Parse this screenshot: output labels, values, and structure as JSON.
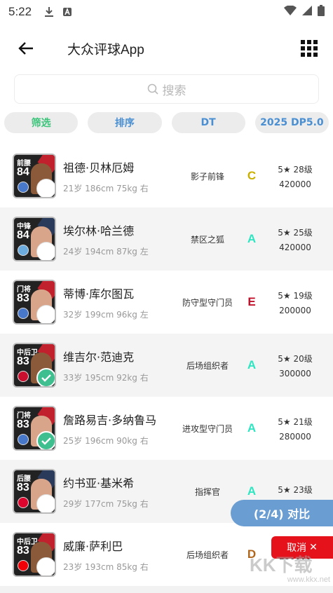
{
  "status": {
    "time": "5:22"
  },
  "header": {
    "title": "大众评球App"
  },
  "search": {
    "placeholder": "搜索"
  },
  "filters": [
    {
      "label": "筛选",
      "color": "#3cc47a"
    },
    {
      "label": "排序",
      "color": "#4a8fd1"
    },
    {
      "label": "DT",
      "color": "#4a8fd1"
    },
    {
      "label": "2025 DP5.0",
      "color": "#4a8fd1"
    }
  ],
  "players": [
    {
      "pos": "前腰",
      "rating": "84",
      "name": "祖德·贝林厄姆",
      "meta": "21岁 186cm 75kg 右",
      "role": "影子前锋",
      "grade": "C",
      "grade_color": "#c9b000",
      "stars_level": "5★ 28级",
      "price": "420000",
      "checked": false
    },
    {
      "pos": "中锋",
      "rating": "84",
      "name": "埃尔林·哈兰德",
      "meta": "24岁 194cm 87kg 左",
      "role": "禁区之狐",
      "grade": "A",
      "grade_color": "#2ce6c2",
      "stars_level": "5★ 25级",
      "price": "420000",
      "checked": false
    },
    {
      "pos": "门将",
      "rating": "83",
      "name": "蒂博·库尔图瓦",
      "meta": "32岁 199cm 96kg 左",
      "role": "防守型守门员",
      "grade": "E",
      "grade_color": "#c0102a",
      "stars_level": "5★ 19级",
      "price": "200000",
      "checked": false
    },
    {
      "pos": "中后卫",
      "rating": "83",
      "name": "维吉尔·范迪克",
      "meta": "33岁 195cm 92kg 右",
      "role": "后场组织者",
      "grade": "A",
      "grade_color": "#2ce6c2",
      "stars_level": "5★ 20级",
      "price": "300000",
      "checked": true
    },
    {
      "pos": "门将",
      "rating": "83",
      "name": "詹路易吉·多纳鲁马",
      "meta": "25岁 196cm 90kg 右",
      "role": "进攻型守门员",
      "grade": "A",
      "grade_color": "#2ce6c2",
      "stars_level": "5★ 21级",
      "price": "280000",
      "checked": true
    },
    {
      "pos": "后腰",
      "rating": "83",
      "name": "约书亚·基米希",
      "meta": "29岁 177cm 75kg 右",
      "role": "指挥官",
      "grade": "A",
      "grade_color": "#2ce6c2",
      "stars_level": "5★ 23级",
      "price": "",
      "checked": false
    },
    {
      "pos": "中后卫",
      "rating": "83",
      "name": "威廉·萨利巴",
      "meta": "23岁 193cm 85kg 右",
      "role": "后场组织者",
      "grade": "D",
      "grade_color": "#b0661c",
      "stars_level": "",
      "price": "280000",
      "checked": false
    }
  ],
  "compare": {
    "label": "(2/4) 对比"
  },
  "cancel": {
    "label": "取消",
    "icon": "close-icon"
  },
  "watermark": {
    "text": "KK下载",
    "url": "www.kkx.net"
  }
}
